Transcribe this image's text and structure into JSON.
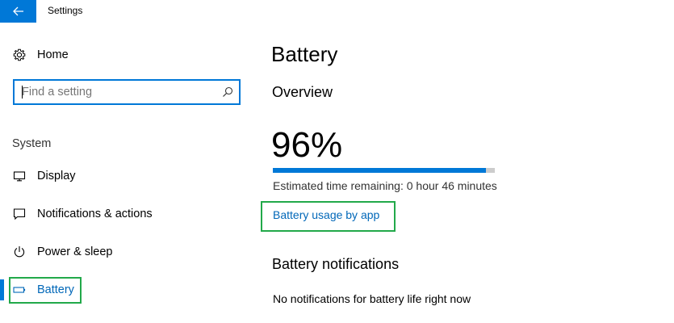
{
  "window": {
    "title": "Settings",
    "accent_color": "#0078d7",
    "highlight_color": "#22a94a"
  },
  "sidebar": {
    "home": {
      "label": "Home",
      "icon": "gear-icon"
    },
    "search": {
      "placeholder": "Find a setting",
      "value": "",
      "icon": "search-icon"
    },
    "section_label": "System",
    "items": [
      {
        "label": "Display",
        "icon": "monitor-icon"
      },
      {
        "label": "Notifications & actions",
        "icon": "notification-icon"
      },
      {
        "label": "Power & sleep",
        "icon": "power-icon"
      },
      {
        "label": "Battery",
        "icon": "battery-icon",
        "selected": true
      }
    ]
  },
  "main": {
    "title": "Battery",
    "overview": {
      "heading": "Overview",
      "percent_text": "96%",
      "charge_fraction": 0.96,
      "estimate_text": "Estimated time remaining: 0 hour 46 minutes",
      "usage_link": "Battery usage by app"
    },
    "notifications": {
      "heading": "Battery notifications",
      "text": "No notifications for battery life right now"
    }
  }
}
